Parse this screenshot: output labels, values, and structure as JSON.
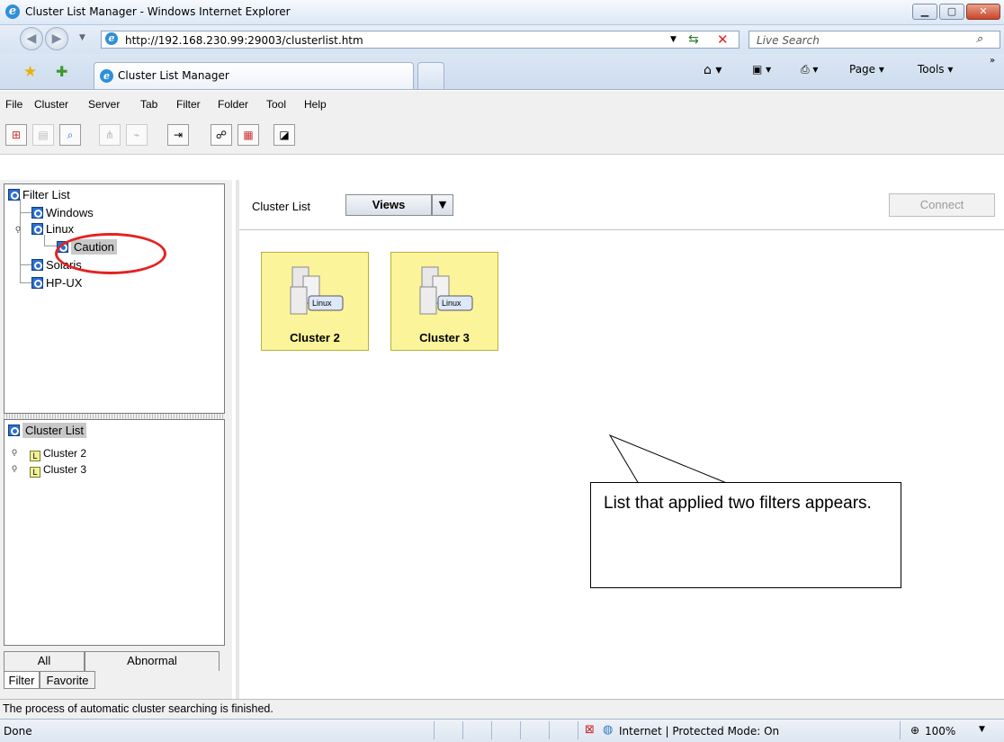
{
  "window": {
    "title": "Cluster List Manager - Windows Internet Explorer",
    "buttons": [
      "minimize",
      "maximize",
      "close"
    ]
  },
  "addressbar": {
    "url": "http://192.168.230.99:29003/clusterlist.htm",
    "search_placeholder": "Live Search"
  },
  "tabbar": {
    "tab_title": "Cluster List Manager",
    "commands": {
      "page": "Page ▾",
      "tools": "Tools ▾"
    }
  },
  "menubar": {
    "items": [
      "File",
      "Cluster",
      "Server",
      "Tab",
      "Filter",
      "Folder",
      "Tool",
      "Help"
    ]
  },
  "filter_tree": {
    "root": "Filter List",
    "items": [
      "Windows",
      "Linux",
      "Caution",
      "Solaris",
      "HP-UX"
    ]
  },
  "cluster_tree": {
    "root": "Cluster List",
    "items": [
      "Cluster 2",
      "Cluster 3"
    ]
  },
  "left_tabs": {
    "row1": [
      "All",
      "Abnormal"
    ],
    "row2": [
      "Filter",
      "Favorite"
    ]
  },
  "main": {
    "header_label": "Cluster List",
    "views_label": "Views",
    "connect_label": "Connect",
    "cards": [
      {
        "name": "Cluster 2",
        "os_badge": "Linux"
      },
      {
        "name": "Cluster 3",
        "os_badge": "Linux"
      }
    ]
  },
  "callout": {
    "text": "List that applied two filters appears."
  },
  "app_status": "The process of automatic cluster searching is finished.",
  "ie_status": {
    "left": "Done",
    "zone": "Internet | Protected Mode: On",
    "zoom": "100%"
  },
  "colors": {
    "card_bg": "#fbf49a",
    "highlight_circle": "#e32222",
    "ie_chrome": "#dce8f6"
  }
}
